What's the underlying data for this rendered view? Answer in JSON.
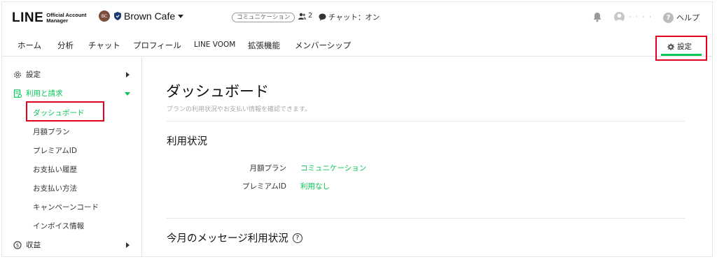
{
  "header": {
    "logo_main": "LINE",
    "logo_sub_line1": "Official Account",
    "logo_sub_line2": "Manager",
    "account_avatar_text": "BC",
    "account_name": "Brown Cafe",
    "plan_badge": "コミュニケーション",
    "friends_count": "2",
    "chat_status": "チャット：オン",
    "user_name_masked": "· · · ·",
    "help_label": "ヘルプ"
  },
  "nav": {
    "items": [
      "ホーム",
      "分析",
      "チャット",
      "プロフィール",
      "LINE VOOM",
      "拡張機能",
      "メンバーシップ"
    ],
    "settings_label": "設定"
  },
  "sidebar": {
    "settings_label": "設定",
    "billing_label": "利用と請求",
    "sub_items": [
      "ダッシュボード",
      "月額プラン",
      "プレミアムID",
      "お支払い履歴",
      "お支払い方法",
      "キャンペーンコード",
      "インボイス情報"
    ],
    "revenue_label": "収益"
  },
  "main": {
    "title": "ダッシュボード",
    "description": "プランの利用状況やお支払い情報を確認できます。",
    "usage_title": "利用状況",
    "usage_rows": [
      {
        "label": "月額プラン",
        "value": "コミュニケーション"
      },
      {
        "label": "プレミアムID",
        "value": "利用なし"
      }
    ],
    "message_usage_title": "今月のメッセージ利用状況",
    "message_usage_help": "?"
  },
  "colors": {
    "accent_green": "#06c755",
    "highlight_red": "#e3001b"
  }
}
